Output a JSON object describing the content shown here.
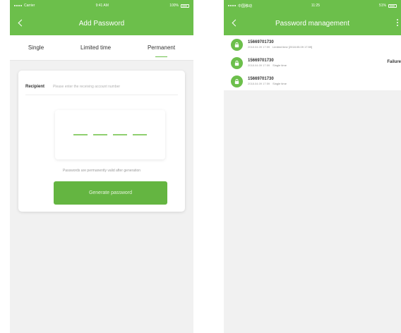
{
  "left": {
    "status": {
      "carrier": "Carrier",
      "time": "9:41 AM",
      "battery_label": "100%"
    },
    "title": "Add Password",
    "tabs": [
      {
        "label": "Single",
        "active": false
      },
      {
        "label": "Limited time",
        "active": false
      },
      {
        "label": "Permanent",
        "active": true
      }
    ],
    "recipient_label": "Recipient",
    "recipient_placeholder": "Please enter the receiving account number",
    "password_slots": 4,
    "hint": "Passwords are permanently valid after generation",
    "generate_button": "Generate password"
  },
  "right": {
    "status": {
      "left": "中国移动",
      "time": "11:25",
      "battery_label": "51%"
    },
    "title": "Password management",
    "items": [
      {
        "phone": "15669701730",
        "meta": "2018.04.09 17:59",
        "type": "Limited time [2018.05.09 17:59]",
        "status": ""
      },
      {
        "phone": "15669701730",
        "meta": "2018.04.09 17:59",
        "type": "Single time",
        "status": "Failure"
      },
      {
        "phone": "15669701730",
        "meta": "2018.04.09 17:59",
        "type": "Single time",
        "status": ""
      }
    ]
  },
  "colors": {
    "accent": "#6cbf4b",
    "button": "#64b541",
    "background": "#f1f1f1"
  }
}
